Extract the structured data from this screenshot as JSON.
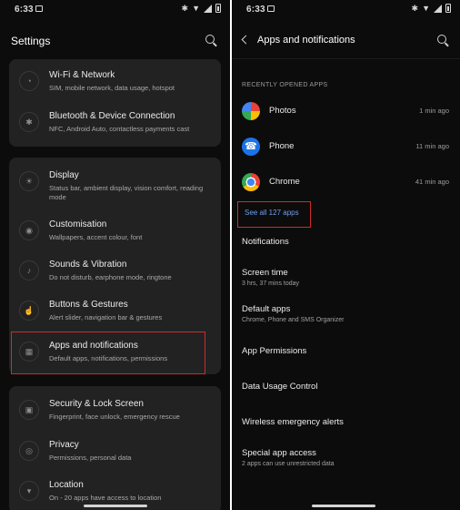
{
  "status_bar": {
    "time": "6:33"
  },
  "left": {
    "title": "Settings",
    "cards": [
      {
        "items": [
          {
            "title": "Wi-Fi & Network",
            "subtitle": "SIM, mobile network, data usage, hotspot",
            "icon": "wifi-icon"
          },
          {
            "title": "Bluetooth & Device Connection",
            "subtitle": "NFC, Android Auto, contactless payments cast",
            "icon": "bluetooth-icon"
          }
        ]
      },
      {
        "items": [
          {
            "title": "Display",
            "subtitle": "Status bar, ambient display, vision comfort, reading mode",
            "icon": "brightness-icon"
          },
          {
            "title": "Customisation",
            "subtitle": "Wallpapers, accent colour, font",
            "icon": "palette-icon"
          },
          {
            "title": "Sounds & Vibration",
            "subtitle": "Do not disturb, earphone mode, ringtone",
            "icon": "speaker-icon"
          },
          {
            "title": "Buttons & Gestures",
            "subtitle": "Alert slider, navigation bar & gestures",
            "icon": "gesture-icon"
          },
          {
            "title": "Apps and notifications",
            "subtitle": "Default apps, notifications, permissions",
            "icon": "apps-grid-icon"
          }
        ]
      },
      {
        "items": [
          {
            "title": "Security & Lock Screen",
            "subtitle": "Fingerprint, face unlock, emergency rescue",
            "icon": "lock-icon"
          },
          {
            "title": "Privacy",
            "subtitle": "Permissions, personal data",
            "icon": "privacy-icon"
          },
          {
            "title": "Location",
            "subtitle": "On - 20 apps have access to location",
            "icon": "location-pin-icon"
          }
        ]
      }
    ]
  },
  "right": {
    "title": "Apps and notifications",
    "section_label": "RECENTLY OPENED APPS",
    "recent_apps": [
      {
        "name": "Photos",
        "time": "1 min ago",
        "icon": "photos-icon"
      },
      {
        "name": "Phone",
        "time": "11 min ago",
        "icon": "phone-icon"
      },
      {
        "name": "Chrome",
        "time": "41 min ago",
        "icon": "chrome-icon"
      }
    ],
    "see_all": "See all 127 apps",
    "menu": [
      {
        "title": "Notifications",
        "subtitle": ""
      },
      {
        "title": "Screen time",
        "subtitle": "3 hrs, 37 mins today"
      },
      {
        "title": "Default apps",
        "subtitle": "Chrome, Phone and SMS Organizer"
      },
      {
        "title": "App Permissions",
        "subtitle": ""
      },
      {
        "title": "Data Usage Control",
        "subtitle": ""
      },
      {
        "title": "Wireless emergency alerts",
        "subtitle": ""
      },
      {
        "title": "Special app access",
        "subtitle": "2 apps can use unrestricted data"
      }
    ]
  },
  "colors": {
    "background": "#0c0c0c",
    "card": "#222222",
    "link": "#6f9ef0",
    "highlight": "#d12a2a"
  }
}
